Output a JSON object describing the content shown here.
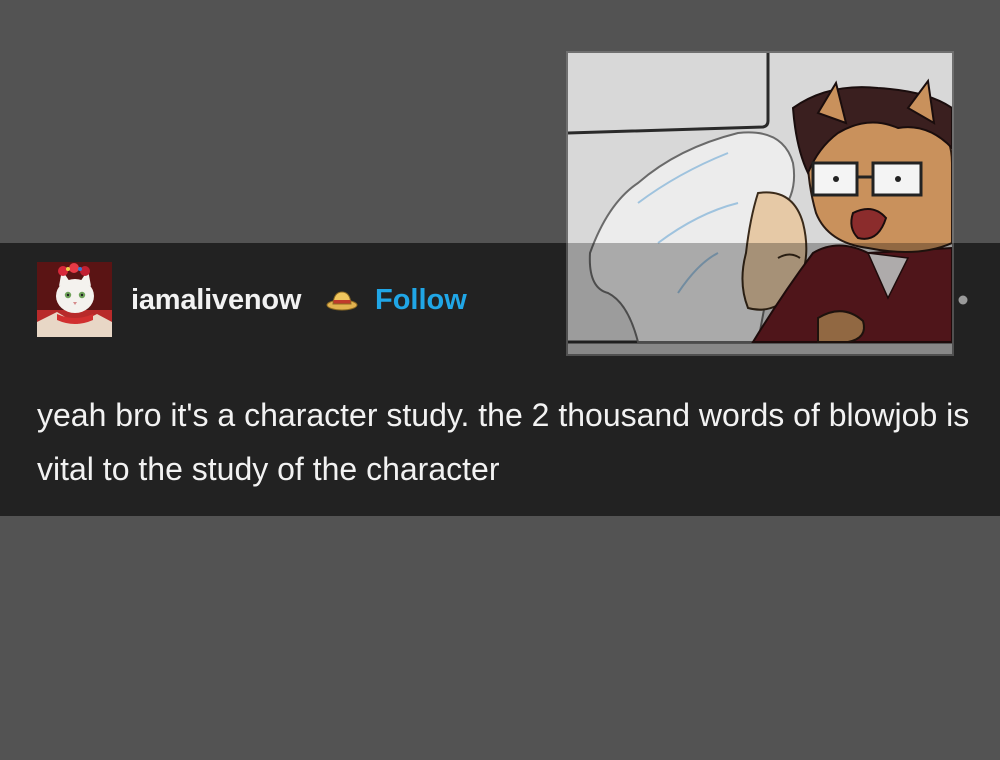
{
  "post": {
    "username": "iamalivenow",
    "badge_icon": "straw-hat-icon",
    "follow_label": "Follow",
    "menu_icon": "more-options-icon",
    "text": "yeah bro it's a character study. the 2 thousand words of blowjob is vital to the study of the character"
  },
  "avatar": {
    "icon": "cat-avatar-image"
  },
  "colors": {
    "page_background": "#535353",
    "post_background": "#222222",
    "text": "#f2f2f2",
    "follow": "#20a6e6"
  }
}
